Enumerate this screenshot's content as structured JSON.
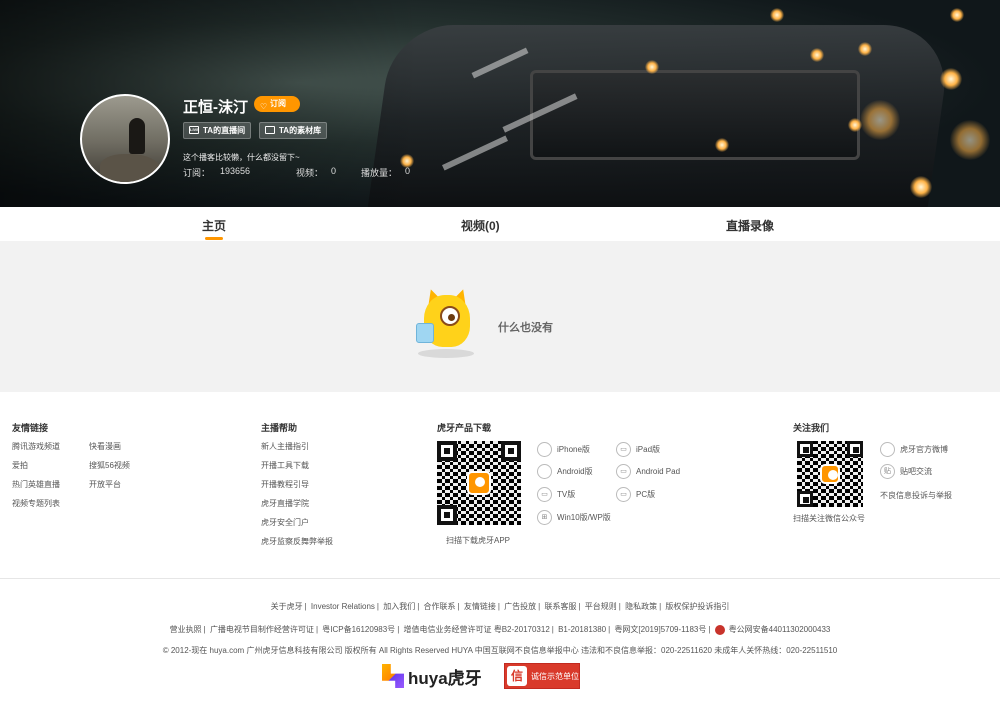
{
  "profile": {
    "name": "正恒-沫汀",
    "subscribe_label": "订阅",
    "live_room_label": "TA的直播间",
    "material_label": "TA的素材库",
    "bio": "这个播客比较懒，什么都没留下~",
    "stats": {
      "subs_label": "订阅：",
      "subs_value": "193656",
      "videos_label": "视频：",
      "videos_value": "0",
      "plays_label": "播放量：",
      "plays_value": "0"
    }
  },
  "tabs": [
    {
      "label": "主页",
      "active": true
    },
    {
      "label": "视频(0)",
      "active": false
    },
    {
      "label": "直播录像",
      "active": false
    }
  ],
  "empty": {
    "text": "什么也没有"
  },
  "footer": {
    "friend_links": {
      "title": "友情链接",
      "col1": [
        "腾讯游戏频道",
        "爱拍",
        "热门英雄直播",
        "视频专题列表"
      ],
      "col2": [
        "快看漫画",
        "搜狐56视频",
        "开放平台"
      ]
    },
    "streamer_help": {
      "title": "主播帮助",
      "items": [
        "新人主播指引",
        "开播工具下载",
        "开播教程引导",
        "虎牙直播学院",
        "虎牙安全门户",
        "虎牙监察反舞弊举报"
      ]
    },
    "download": {
      "title": "虎牙产品下载",
      "caption": "扫描下载虎牙APP",
      "items": [
        "iPhone版",
        "iPad版",
        "Android版",
        "Android Pad",
        "TV版",
        "PC版",
        "Win10版/WP版"
      ]
    },
    "follow": {
      "title": "关注我们",
      "caption": "扫描关注微信公众号",
      "items": [
        "虎牙官方微博",
        "贴吧交流",
        "不良信息投诉与举报"
      ]
    },
    "nav_links": [
      "关于虎牙",
      "Investor Relations",
      "加入我们",
      "合作联系",
      "友情链接",
      "广告投放",
      "联系客服",
      "平台规则",
      "隐私政策",
      "版权保护投诉指引"
    ],
    "license_line": [
      "营业执照",
      "广播电视节目制作经营许可证",
      "粤ICP备16120983号",
      "增值电信业务经营许可证 粤B2-20170312",
      "B1-20181380",
      "粤网文[2019]5709-1183号"
    ],
    "police_record": "粤公网安备44011302000433",
    "copyright": "© 2012-现在 huya.com 广州虎牙信息科技有限公司 版权所有 All Rights Reserved  HUYA   中国互联网不良信息举报中心   违法和不良信息举报：020-22511620   未成年人关怀热线：020-22511510",
    "logo_text": "huya虎牙",
    "credit_badge": "诚信示范单位",
    "credit_seal": "信"
  },
  "colors": {
    "accent": "#ff9600",
    "banner_dark": "#10171a",
    "empty_bg": "#f2f2f2"
  }
}
